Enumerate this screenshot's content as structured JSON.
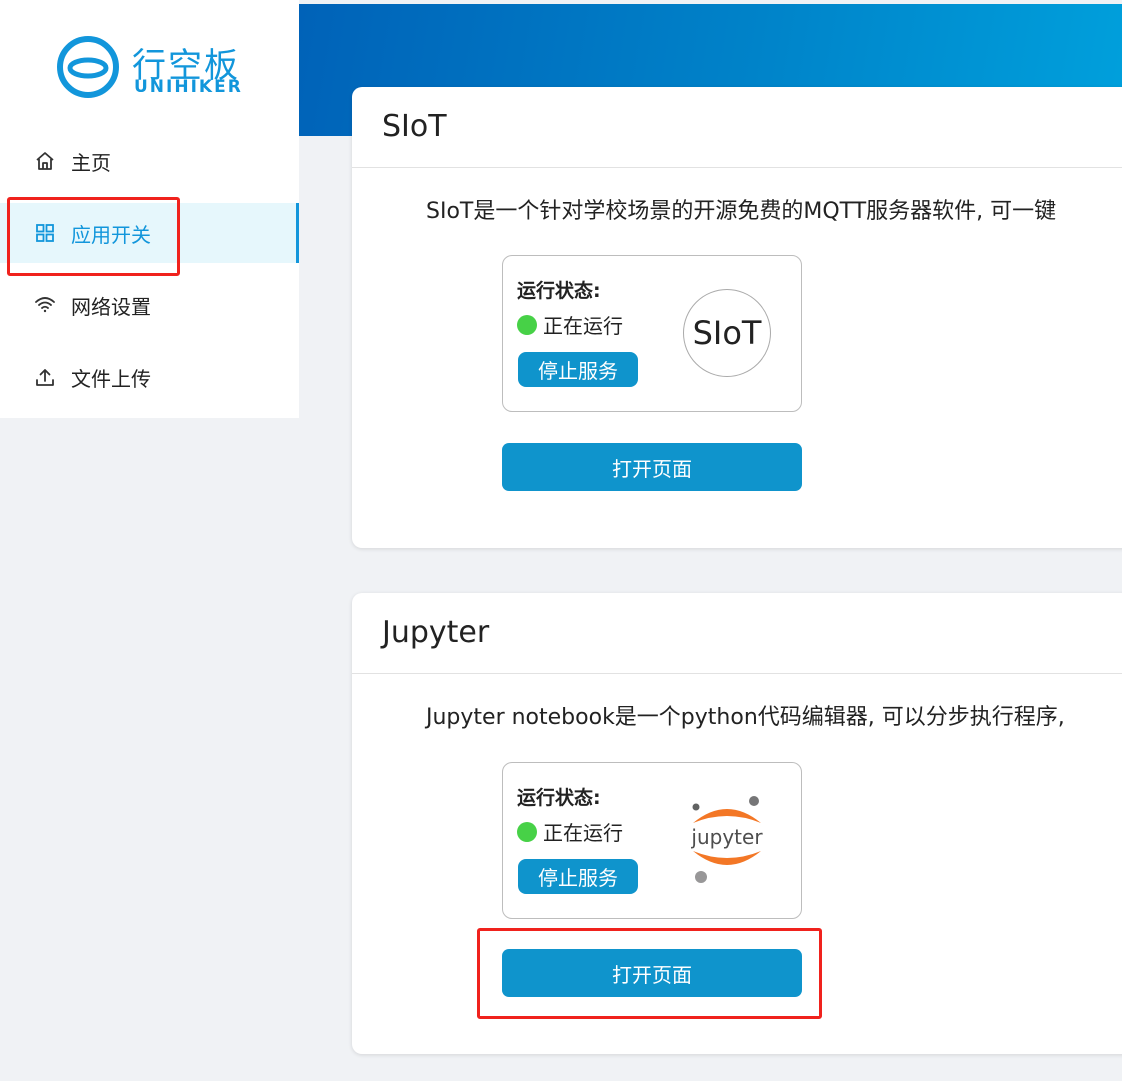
{
  "brand": {
    "name_cn": "行空板",
    "name_en": "UNIHIKER",
    "color": "#1296db"
  },
  "sidebar": {
    "items": [
      {
        "label": "主页",
        "icon": "home-icon",
        "active": false
      },
      {
        "label": "应用开关",
        "icon": "grid-icon",
        "active": true
      },
      {
        "label": "网络设置",
        "icon": "wifi-icon",
        "active": false
      },
      {
        "label": "文件上传",
        "icon": "upload-icon",
        "active": false
      }
    ]
  },
  "apps": [
    {
      "title": "SIoT",
      "description": "SIoT是一个针对学校场景的开源免费的MQTT服务器软件, 可一键",
      "status_label": "运行状态:",
      "status_text": "正在运行",
      "stop_label": "停止服务",
      "open_label": "打开页面",
      "logo_text": "SIoT"
    },
    {
      "title": "Jupyter",
      "description": "Jupyter notebook是一个python代码编辑器, 可以分步执行程序,",
      "status_label": "运行状态:",
      "status_text": "正在运行",
      "stop_label": "停止服务",
      "open_label": "打开页面",
      "logo_text": "jupyter"
    }
  ],
  "colors": {
    "accent": "#0f94cc",
    "running": "#47d147",
    "highlight": "#f0221d",
    "header_start": "#0062b8",
    "header_end": "#00a0dc"
  }
}
